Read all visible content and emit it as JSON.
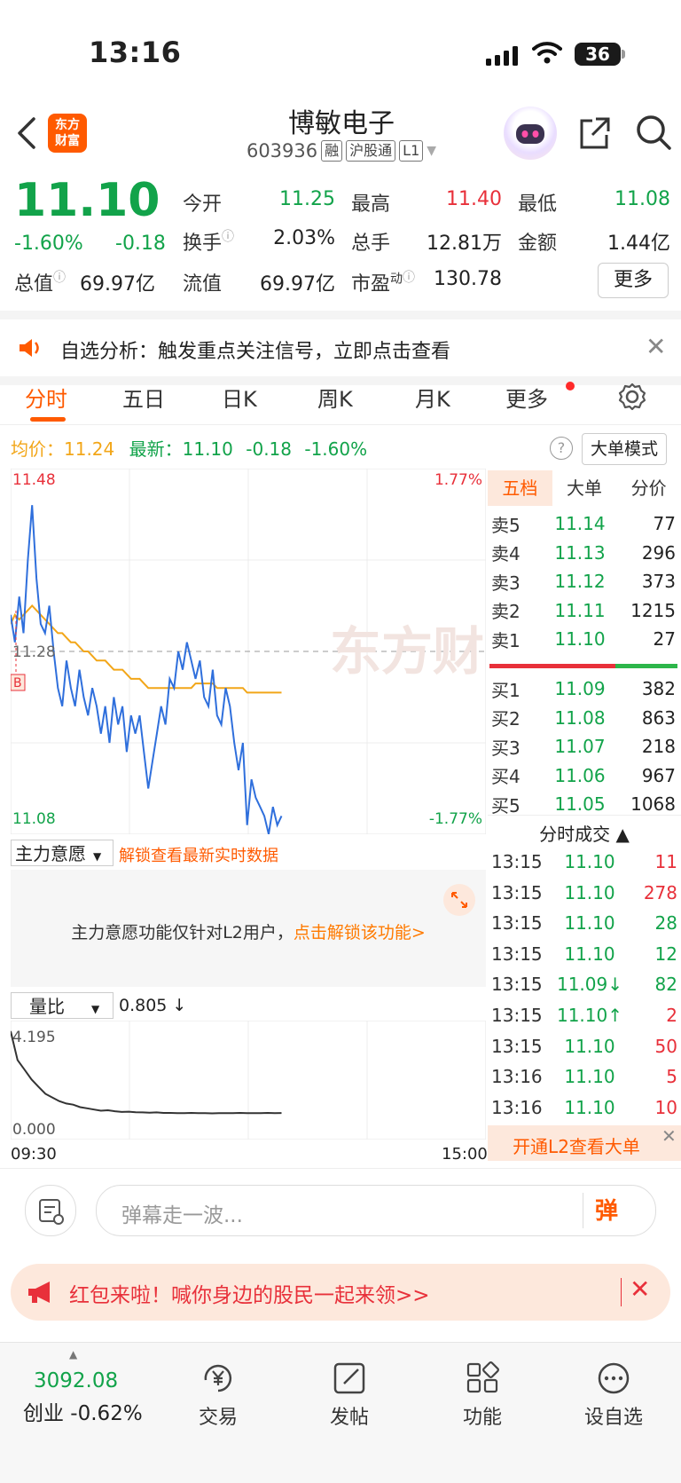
{
  "status_bar": {
    "time": "13:16",
    "battery": "36"
  },
  "header": {
    "logo_text": "东方\n财富",
    "name": "博敏电子",
    "code": "603936",
    "tags": [
      "融",
      "沪股通",
      "L1"
    ]
  },
  "quote": {
    "price": "11.10",
    "change_pct": "-1.60%",
    "change": "-0.18",
    "open_label": "今开",
    "open": "11.25",
    "high_label": "最高",
    "high": "11.40",
    "low_label": "最低",
    "low": "11.08",
    "turnover_label": "换手",
    "turnover": "2.03%",
    "volume_label": "总手",
    "volume": "12.81万",
    "amount_label": "金额",
    "amount": "1.44亿",
    "mktcap_label": "总值",
    "mktcap": "69.97亿",
    "float_label": "流值",
    "float": "69.97亿",
    "pe_label": "市盈",
    "pe_sup": "动",
    "pe": "130.78",
    "more": "更多"
  },
  "notice": {
    "text": "自选分析：触发重点关注信号，立即点击查看"
  },
  "tabs": [
    "分时",
    "五日",
    "日K",
    "周K",
    "月K",
    "更多"
  ],
  "avg_row": {
    "avg_label": "均价：",
    "avg": "11.24",
    "latest_label": "最新：",
    "latest": "11.10",
    "chg": "-0.18",
    "pct": "-1.60%",
    "big_order": "大单模式"
  },
  "chart_data": {
    "type": "line",
    "y_top": "11.48",
    "y_mid": "11.28",
    "y_bottom": "11.08",
    "pct_top": "1.77%",
    "pct_bottom": "-1.77%",
    "ylim": [
      11.08,
      11.48
    ],
    "prev_close": 11.28,
    "buy_marker": "B",
    "series": [
      {
        "values": [
          11.32,
          11.29,
          11.34,
          11.3,
          11.38,
          11.44,
          11.36,
          11.31,
          11.3,
          11.33,
          11.28,
          11.24,
          11.22,
          11.27,
          11.24,
          11.22,
          11.26,
          11.23,
          11.21,
          11.24,
          11.22,
          11.19,
          11.22,
          11.18,
          11.23,
          11.2,
          11.22,
          11.17,
          11.21,
          11.19,
          11.21,
          11.17,
          11.13,
          11.16,
          11.19,
          11.22,
          11.2,
          11.25,
          11.24,
          11.28,
          11.26,
          11.29,
          11.27,
          11.25,
          11.27,
          11.23,
          11.22,
          11.26,
          11.21,
          11.2,
          11.24,
          11.22,
          11.18,
          11.15,
          11.18,
          11.09,
          11.14,
          11.12,
          11.11,
          11.1,
          11.08,
          11.11,
          11.09,
          11.1
        ]
      },
      {
        "values": [
          11.31,
          11.32,
          11.315,
          11.32,
          11.325,
          11.33,
          11.325,
          11.32,
          11.315,
          11.31,
          11.305,
          11.3,
          11.3,
          11.295,
          11.29,
          11.29,
          11.285,
          11.28,
          11.28,
          11.275,
          11.27,
          11.27,
          11.27,
          11.265,
          11.26,
          11.26,
          11.26,
          11.255,
          11.25,
          11.25,
          11.25,
          11.245,
          11.24,
          11.24,
          11.24,
          11.24,
          11.24,
          11.24,
          11.24,
          11.24,
          11.24,
          11.24,
          11.24,
          11.245,
          11.245,
          11.245,
          11.245,
          11.245,
          11.24,
          11.24,
          11.24,
          11.24,
          11.24,
          11.24,
          11.24,
          11.235,
          11.235,
          11.235,
          11.235,
          11.235,
          11.235,
          11.235,
          11.235,
          11.235
        ]
      }
    ],
    "colors": {
      "price": "#2f6fdc",
      "avg": "#f2a618"
    }
  },
  "order_book": {
    "tabs": [
      "五档",
      "大单",
      "分价"
    ],
    "asks": [
      {
        "label": "卖5",
        "price": "11.14",
        "vol": "77"
      },
      {
        "label": "卖4",
        "price": "11.13",
        "vol": "296"
      },
      {
        "label": "卖3",
        "price": "11.12",
        "vol": "373"
      },
      {
        "label": "卖2",
        "price": "11.11",
        "vol": "1215"
      },
      {
        "label": "卖1",
        "price": "11.10",
        "vol": "27"
      }
    ],
    "bids": [
      {
        "label": "买1",
        "price": "11.09",
        "vol": "382"
      },
      {
        "label": "买2",
        "price": "11.08",
        "vol": "863"
      },
      {
        "label": "买3",
        "price": "11.07",
        "vol": "218"
      },
      {
        "label": "买4",
        "price": "11.06",
        "vol": "967"
      },
      {
        "label": "买5",
        "price": "11.05",
        "vol": "1068"
      }
    ]
  },
  "trades": {
    "title": "分时成交 ▲",
    "rows": [
      {
        "t": "13:15",
        "p": "11.10",
        "v": "11",
        "vc": "red"
      },
      {
        "t": "13:15",
        "p": "11.10",
        "v": "278",
        "vc": "red"
      },
      {
        "t": "13:15",
        "p": "11.10",
        "v": "28",
        "vc": "green"
      },
      {
        "t": "13:15",
        "p": "11.10",
        "v": "12",
        "vc": "green"
      },
      {
        "t": "13:15",
        "p": "11.09↓",
        "v": "82",
        "vc": "green"
      },
      {
        "t": "13:15",
        "p": "11.10↑",
        "v": "2",
        "vc": "red"
      },
      {
        "t": "13:15",
        "p": "11.10",
        "v": "50",
        "vc": "red"
      },
      {
        "t": "13:16",
        "p": "11.10",
        "v": "5",
        "vc": "red"
      },
      {
        "t": "13:16",
        "p": "11.10",
        "v": "10",
        "vc": "red"
      }
    ],
    "l2": "开通L2查看大单"
  },
  "main_force": {
    "select": "主力意愿",
    "unlock": "解锁查看最新实时数据",
    "msg": "主力意愿功能仅针对L2用户，",
    "msg_link": "点击解锁该功能>"
  },
  "volume_ratio": {
    "select": "量比",
    "value": "0.805 ↓",
    "top": "4.195",
    "bottom": "0.000",
    "values": [
      4.2,
      3.0,
      2.6,
      2.2,
      1.9,
      1.6,
      1.45,
      1.3,
      1.2,
      1.15,
      1.05,
      1.0,
      0.95,
      0.9,
      0.92,
      0.88,
      0.85,
      0.86,
      0.84,
      0.83,
      0.82,
      0.83,
      0.81,
      0.81,
      0.8,
      0.8,
      0.81,
      0.8,
      0.8,
      0.79,
      0.8,
      0.8,
      0.8,
      0.81,
      0.8,
      0.8,
      0.8,
      0.81,
      0.8,
      0.805
    ]
  },
  "time_axis": {
    "start": "09:30",
    "end": "15:00"
  },
  "comment": {
    "placeholder": "弹幕走一波...",
    "btn": "弹"
  },
  "red_packet": {
    "text": "红包来啦！喊你身边的股民一起来领>>"
  },
  "bottom_nav": {
    "index_value": "3092.08",
    "index_name": "创业 -0.62%",
    "items": [
      "交易",
      "发帖",
      "功能",
      "设自选"
    ]
  },
  "watermark": "东方财富"
}
